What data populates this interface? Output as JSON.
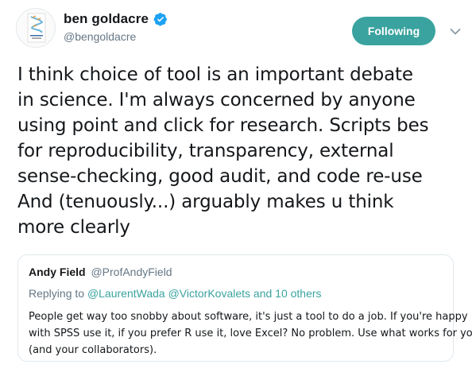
{
  "author": {
    "display_name": "ben goldacre",
    "handle": "@bengoldacre",
    "verified_icon": "verified-badge-icon",
    "avatar_icon": "book-cover-avatar"
  },
  "follow_button": {
    "label": "Following",
    "color": "#3aa39f"
  },
  "menu": {
    "icon": "chevron-down-icon"
  },
  "tweet": {
    "text": "I think choice of tool is an important debate\nin science. I'm always concerned by anyone\nusing point and click for research. Scripts bes\nfor reproducibility, transparency, external\nsense-checking, good audit, and code re-use\nAnd (tenuously...) arguably makes u think\nmore clearly"
  },
  "quoted_tweet": {
    "display_name": "Andy Field",
    "handle": "@ProfAndyField",
    "replying_prefix": "Replying to",
    "mentions": "@LaurentWada @VictorKovalets",
    "others": "and 10 others",
    "text": "People get way too snobby about software, it's just a tool to do a job. If you're happy\nwith SPSS use it, if you prefer R use it, love Excel? No problem. Use what works for you\n(and your collaborators)."
  },
  "colors": {
    "accent": "#3aa39f",
    "verified": "#1da1f2",
    "secondary_text": "#657786",
    "border": "#e1e8ed"
  }
}
